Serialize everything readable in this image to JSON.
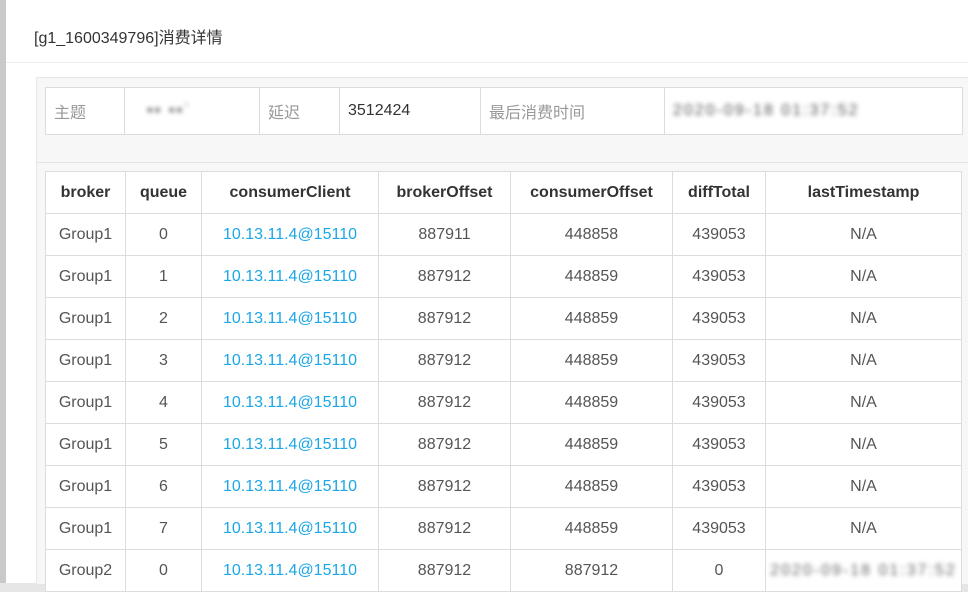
{
  "dialog": {
    "title": "[g1_1600349796]消费详情"
  },
  "summary": {
    "topic_label": "主题",
    "topic_value": "▪▪ ▪▪`",
    "delay_label": "延迟",
    "delay_value": "3512424",
    "last_consume_label": "最后消费时间",
    "last_consume_value": "2020-09-18 01:37:52"
  },
  "table": {
    "headers": [
      "broker",
      "queue",
      "consumerClient",
      "brokerOffset",
      "consumerOffset",
      "diffTotal",
      "lastTimestamp"
    ],
    "rows": [
      {
        "broker": "Group1",
        "queue": "0",
        "client": "10.13.11.4@15110",
        "brokerOffset": "887911",
        "consumerOffset": "448858",
        "diffTotal": "439053",
        "lastTimestamp": "N/A"
      },
      {
        "broker": "Group1",
        "queue": "1",
        "client": "10.13.11.4@15110",
        "brokerOffset": "887912",
        "consumerOffset": "448859",
        "diffTotal": "439053",
        "lastTimestamp": "N/A"
      },
      {
        "broker": "Group1",
        "queue": "2",
        "client": "10.13.11.4@15110",
        "brokerOffset": "887912",
        "consumerOffset": "448859",
        "diffTotal": "439053",
        "lastTimestamp": "N/A"
      },
      {
        "broker": "Group1",
        "queue": "3",
        "client": "10.13.11.4@15110",
        "brokerOffset": "887912",
        "consumerOffset": "448859",
        "diffTotal": "439053",
        "lastTimestamp": "N/A"
      },
      {
        "broker": "Group1",
        "queue": "4",
        "client": "10.13.11.4@15110",
        "brokerOffset": "887912",
        "consumerOffset": "448859",
        "diffTotal": "439053",
        "lastTimestamp": "N/A"
      },
      {
        "broker": "Group1",
        "queue": "5",
        "client": "10.13.11.4@15110",
        "brokerOffset": "887912",
        "consumerOffset": "448859",
        "diffTotal": "439053",
        "lastTimestamp": "N/A"
      },
      {
        "broker": "Group1",
        "queue": "6",
        "client": "10.13.11.4@15110",
        "brokerOffset": "887912",
        "consumerOffset": "448859",
        "diffTotal": "439053",
        "lastTimestamp": "N/A"
      },
      {
        "broker": "Group1",
        "queue": "7",
        "client": "10.13.11.4@15110",
        "brokerOffset": "887912",
        "consumerOffset": "448859",
        "diffTotal": "439053",
        "lastTimestamp": "N/A"
      },
      {
        "broker": "Group2",
        "queue": "0",
        "client": "10.13.11.4@15110",
        "brokerOffset": "887912",
        "consumerOffset": "887912",
        "diffTotal": "0",
        "lastTimestamp": "2020-09-18 01:37:52"
      }
    ]
  },
  "colors": {
    "link": "#1aa7e8",
    "border": "#dcdcdc",
    "label": "#999999"
  }
}
